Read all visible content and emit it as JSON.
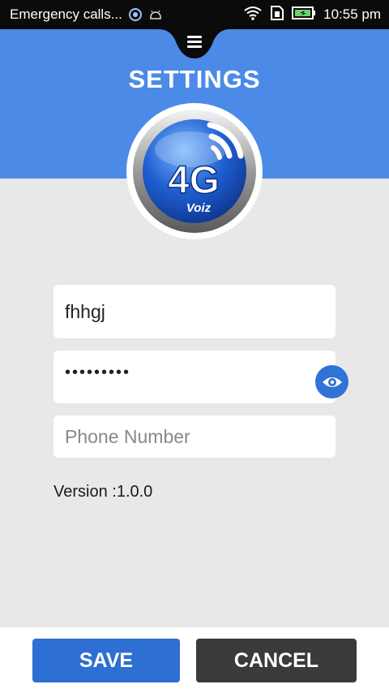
{
  "status_bar": {
    "title": "Emergency calls...",
    "time": "10:55 pm"
  },
  "header": {
    "title": "SETTINGS",
    "bg_color": "#4b8ae6"
  },
  "logo": {
    "main_text": "4G",
    "sub_text": "Voiz"
  },
  "form": {
    "username_value": "fhhgj",
    "password_value": "•••••••••",
    "phone_placeholder": "Phone Number"
  },
  "version": "Version :1.0.0",
  "buttons": {
    "save_label": "SAVE",
    "cancel_label": "CANCEL"
  },
  "icons": [
    "menu-icon",
    "eye-icon",
    "wifi-icon",
    "sim-icon",
    "battery-icon",
    "sync-icon",
    "android-icon"
  ]
}
